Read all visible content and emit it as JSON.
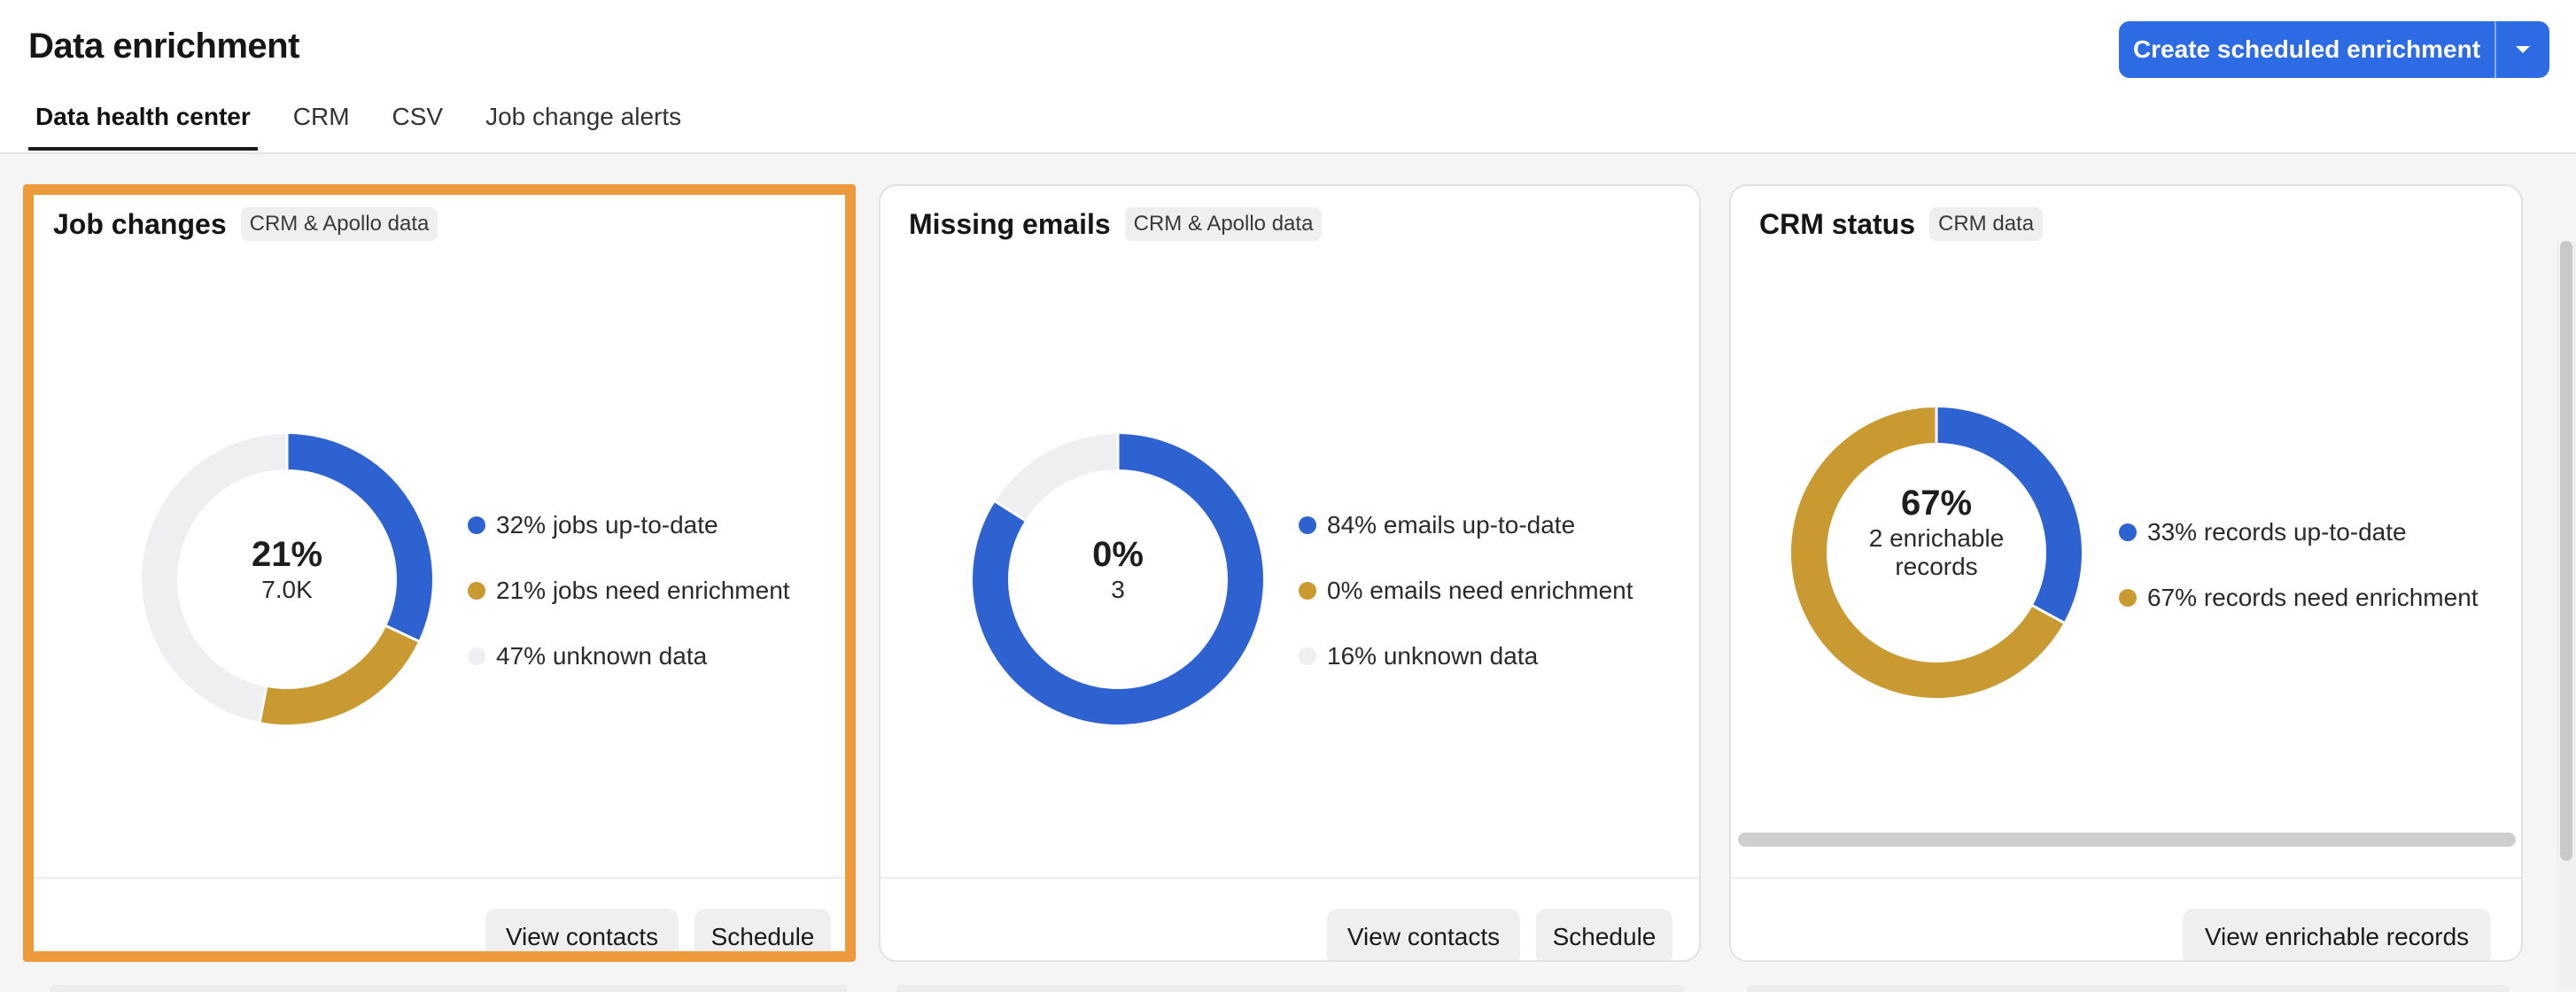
{
  "header": {
    "title": "Data enrichment",
    "tabs": [
      {
        "label": "Data health center",
        "active": true
      },
      {
        "label": "CRM",
        "active": false
      },
      {
        "label": "CSV",
        "active": false
      },
      {
        "label": "Job change alerts",
        "active": false
      }
    ],
    "create_button_label": "Create scheduled enrichment",
    "caret_icon": "chevron-down-icon"
  },
  "colors": {
    "blue": "#2f62d1",
    "gold": "#c99a32",
    "gray": "#efeff1",
    "accent": "#2d6be4",
    "highlight": "#ec9a3b"
  },
  "cards": [
    {
      "title": "Job changes",
      "tag": "CRM & Apollo data",
      "center_value": "21%",
      "center_sub": "7.0K",
      "segments": [
        {
          "label": "32% jobs up-to-date",
          "percent": 32,
          "color": "#2f62d1"
        },
        {
          "label": "21% jobs need enrichment",
          "percent": 21,
          "color": "#c99a32"
        },
        {
          "label": "47% unknown data",
          "percent": 47,
          "color": "#efeff1"
        }
      ],
      "buttons": [
        "View contacts",
        "Schedule"
      ]
    },
    {
      "title": "Missing emails",
      "tag": "CRM & Apollo data",
      "center_value": "0%",
      "center_sub": "3",
      "segments": [
        {
          "label": "84% emails up-to-date",
          "percent": 84,
          "color": "#2f62d1"
        },
        {
          "label": "0% emails need enrichment",
          "percent": 0,
          "color": "#c99a32"
        },
        {
          "label": "16% unknown data",
          "percent": 16,
          "color": "#efeff1"
        }
      ],
      "buttons": [
        "View contacts",
        "Schedule"
      ]
    },
    {
      "title": "CRM status",
      "tag": "CRM data",
      "center_value": "67%",
      "center_sub_line1": "2 enrichable",
      "center_sub_line2": "records",
      "segments": [
        {
          "label": "33% records up-to-date",
          "percent": 33,
          "color": "#2f62d1"
        },
        {
          "label": "67% records need enrichment",
          "percent": 67,
          "color": "#c99a32"
        }
      ],
      "buttons": [
        "View enrichable records"
      ]
    }
  ]
}
